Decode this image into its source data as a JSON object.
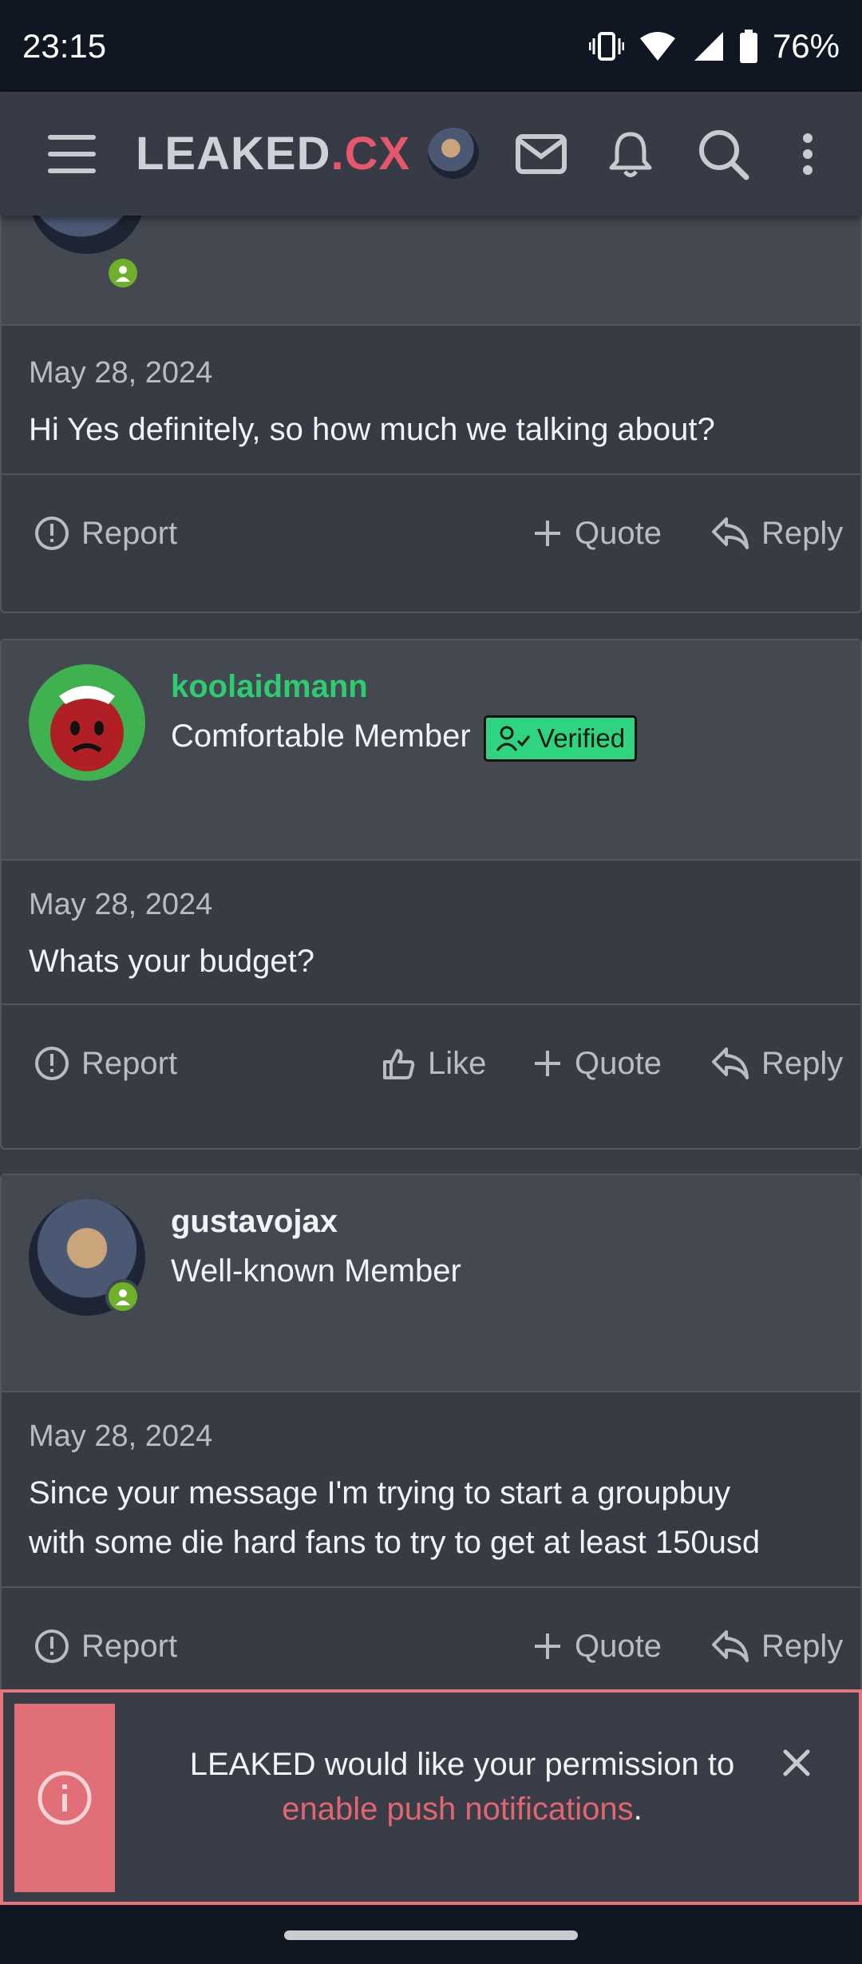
{
  "status_bar": {
    "time": "23:15",
    "battery": "76%"
  },
  "header": {
    "logo_main": "LEAKED",
    "logo_accent": ".CX"
  },
  "posts": [
    {
      "date": "May 28, 2024",
      "text": "Hi Yes definitely, so how much we talking about?",
      "actions": {
        "report": "Report",
        "quote": "Quote",
        "reply": "Reply"
      }
    },
    {
      "username": "koolaidmann",
      "user_title": "Comfortable Member",
      "badge": "Verified",
      "date": "May 28, 2024",
      "text": "Whats your budget?",
      "actions": {
        "report": "Report",
        "like": "Like",
        "quote": "Quote",
        "reply": "Reply"
      }
    },
    {
      "username": "gustavojax",
      "user_title": "Well-known Member",
      "date": "May 28, 2024",
      "text_line1": "Since your message I'm trying to start a groupbuy",
      "text_line2": "with some die hard fans to try to get at least 150usd",
      "actions": {
        "report": "Report",
        "quote": "Quote",
        "reply": "Reply"
      }
    }
  ],
  "toast": {
    "text_before": "LEAKED would like your permission to",
    "link_text": "enable push notifications",
    "text_after": "."
  },
  "colors": {
    "accent": "#e5576a",
    "verified": "#2ed47f",
    "username_green": "#2ecc71",
    "online": "#6fb02a"
  }
}
